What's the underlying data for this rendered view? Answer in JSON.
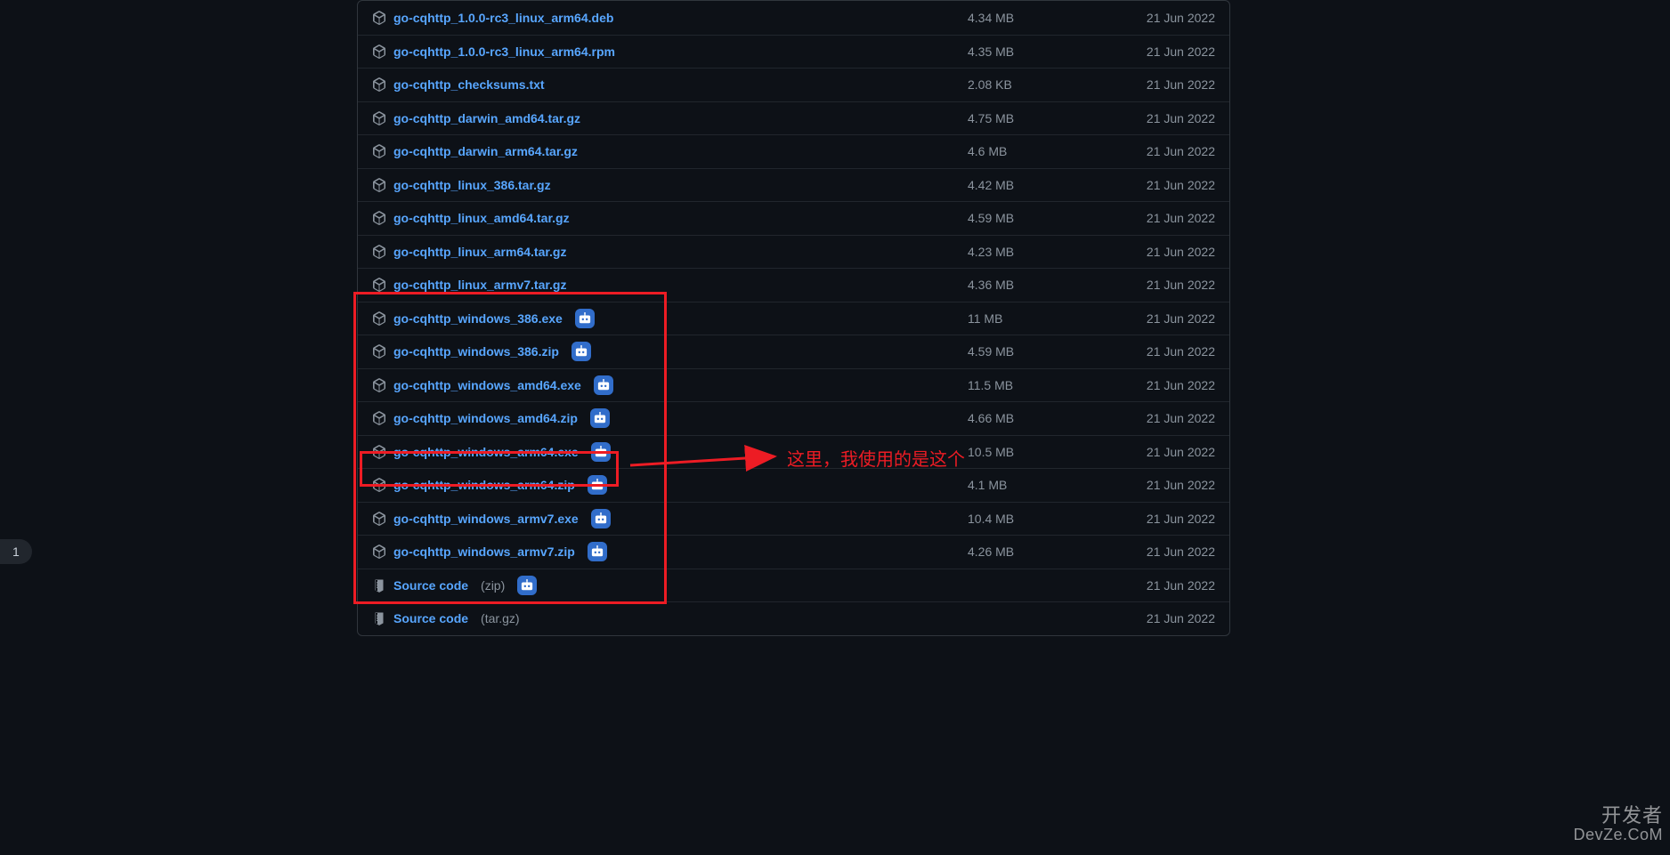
{
  "page_badge": "1",
  "annotation_text": "这里，我使用的是这个",
  "watermark": {
    "line1": "开发者",
    "line2": "DevZe.CoM"
  },
  "assets": [
    {
      "name": "go-cqhttp_1.0.0-rc3_linux_arm64.deb",
      "size": "4.34 MB",
      "date": "21 Jun 2022",
      "icon": "package",
      "badge": false
    },
    {
      "name": "go-cqhttp_1.0.0-rc3_linux_arm64.rpm",
      "size": "4.35 MB",
      "date": "21 Jun 2022",
      "icon": "package",
      "badge": false
    },
    {
      "name": "go-cqhttp_checksums.txt",
      "size": "2.08 KB",
      "date": "21 Jun 2022",
      "icon": "package",
      "badge": false
    },
    {
      "name": "go-cqhttp_darwin_amd64.tar.gz",
      "size": "4.75 MB",
      "date": "21 Jun 2022",
      "icon": "package",
      "badge": false
    },
    {
      "name": "go-cqhttp_darwin_arm64.tar.gz",
      "size": "4.6 MB",
      "date": "21 Jun 2022",
      "icon": "package",
      "badge": false
    },
    {
      "name": "go-cqhttp_linux_386.tar.gz",
      "size": "4.42 MB",
      "date": "21 Jun 2022",
      "icon": "package",
      "badge": false
    },
    {
      "name": "go-cqhttp_linux_amd64.tar.gz",
      "size": "4.59 MB",
      "date": "21 Jun 2022",
      "icon": "package",
      "badge": false
    },
    {
      "name": "go-cqhttp_linux_arm64.tar.gz",
      "size": "4.23 MB",
      "date": "21 Jun 2022",
      "icon": "package",
      "badge": false
    },
    {
      "name": "go-cqhttp_linux_armv7.tar.gz",
      "size": "4.36 MB",
      "date": "21 Jun 2022",
      "icon": "package",
      "badge": false
    },
    {
      "name": "go-cqhttp_windows_386.exe",
      "size": "11 MB",
      "date": "21 Jun 2022",
      "icon": "package",
      "badge": true
    },
    {
      "name": "go-cqhttp_windows_386.zip",
      "size": "4.59 MB",
      "date": "21 Jun 2022",
      "icon": "package",
      "badge": true
    },
    {
      "name": "go-cqhttp_windows_amd64.exe",
      "size": "11.5 MB",
      "date": "21 Jun 2022",
      "icon": "package",
      "badge": true
    },
    {
      "name": "go-cqhttp_windows_amd64.zip",
      "size": "4.66 MB",
      "date": "21 Jun 2022",
      "icon": "package",
      "badge": true
    },
    {
      "name": "go-cqhttp_windows_arm64.exe",
      "size": "10.5 MB",
      "date": "21 Jun 2022",
      "icon": "package",
      "badge": true
    },
    {
      "name": "go-cqhttp_windows_arm64.zip",
      "size": "4.1 MB",
      "date": "21 Jun 2022",
      "icon": "package",
      "badge": true
    },
    {
      "name": "go-cqhttp_windows_armv7.exe",
      "size": "10.4 MB",
      "date": "21 Jun 2022",
      "icon": "package",
      "badge": true
    },
    {
      "name": "go-cqhttp_windows_armv7.zip",
      "size": "4.26 MB",
      "date": "21 Jun 2022",
      "icon": "package",
      "badge": true
    },
    {
      "name": "Source code",
      "suffix": "(zip)",
      "size": "",
      "date": "21 Jun 2022",
      "icon": "zip",
      "badge": true
    },
    {
      "name": "Source code",
      "suffix": "(tar.gz)",
      "size": "",
      "date": "21 Jun 2022",
      "icon": "zip",
      "badge": false
    }
  ]
}
